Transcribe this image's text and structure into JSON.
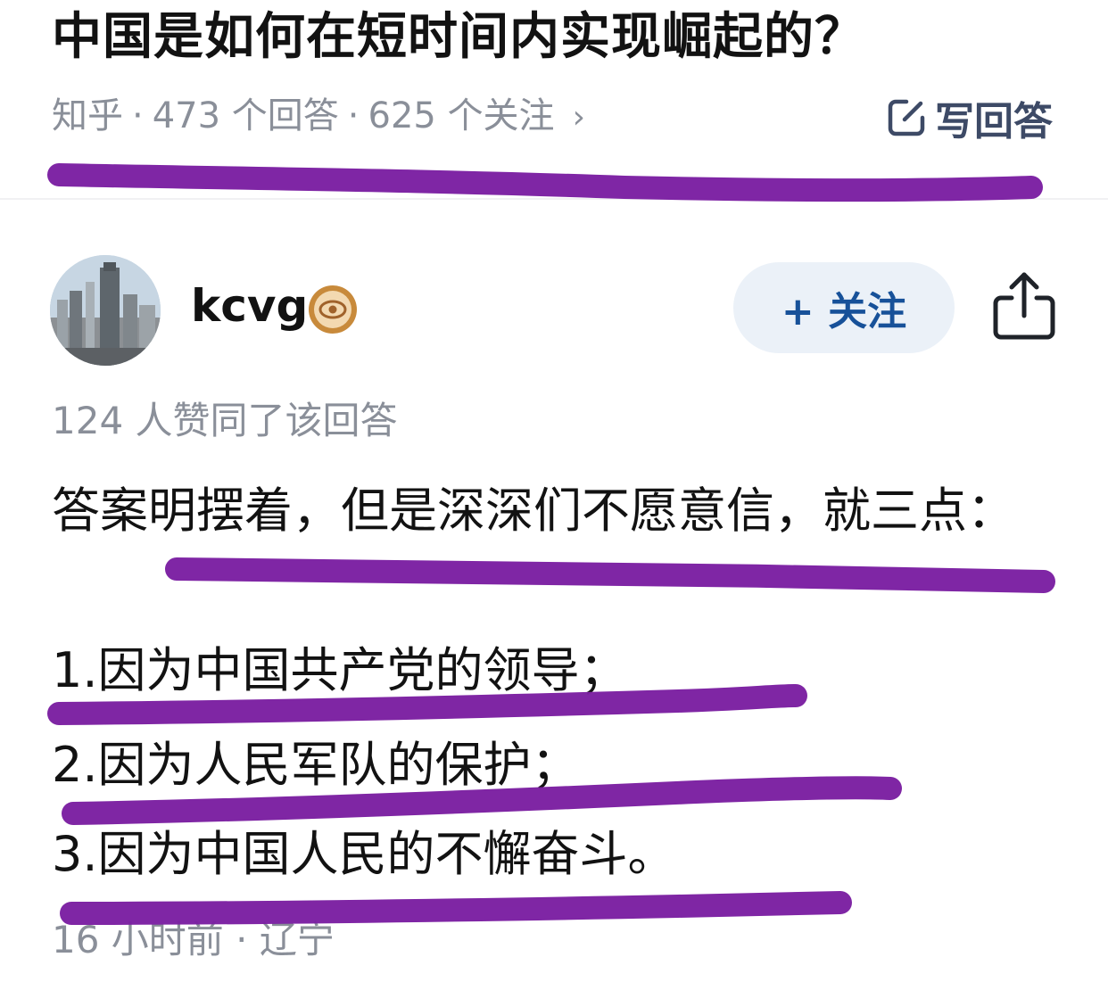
{
  "question": {
    "title": "中国是如何在短时间内实现崛起的？",
    "source": "知乎",
    "answers_count": "473 个回答",
    "followers_count": "625 个关注",
    "separator": "·",
    "chevron": "›",
    "write_answer_label": "写回答"
  },
  "answer": {
    "author": "kcvg",
    "follow_label": "+ 关注",
    "agree_text": "124 人赞同了该回答",
    "intro": "答案明摆着，但是深深们不愿意信，就三点：",
    "points": [
      "1.因为中国共产党的领导；",
      "2.因为人民军队的保护；",
      "3.因为中国人民的不懈奋斗。"
    ],
    "time": "16 小时前",
    "location": "辽宁",
    "separator": "·"
  },
  "colors": {
    "text_primary": "#121212",
    "text_secondary": "#8a8f99",
    "follow_text": "#175199",
    "follow_bg": "#ebf1f8",
    "highlight_stroke": "#7b1fa2",
    "badge": "#c88a3b"
  },
  "icons": {
    "write": "edit-icon",
    "share": "share-icon",
    "badge": "eye-badge-icon"
  }
}
